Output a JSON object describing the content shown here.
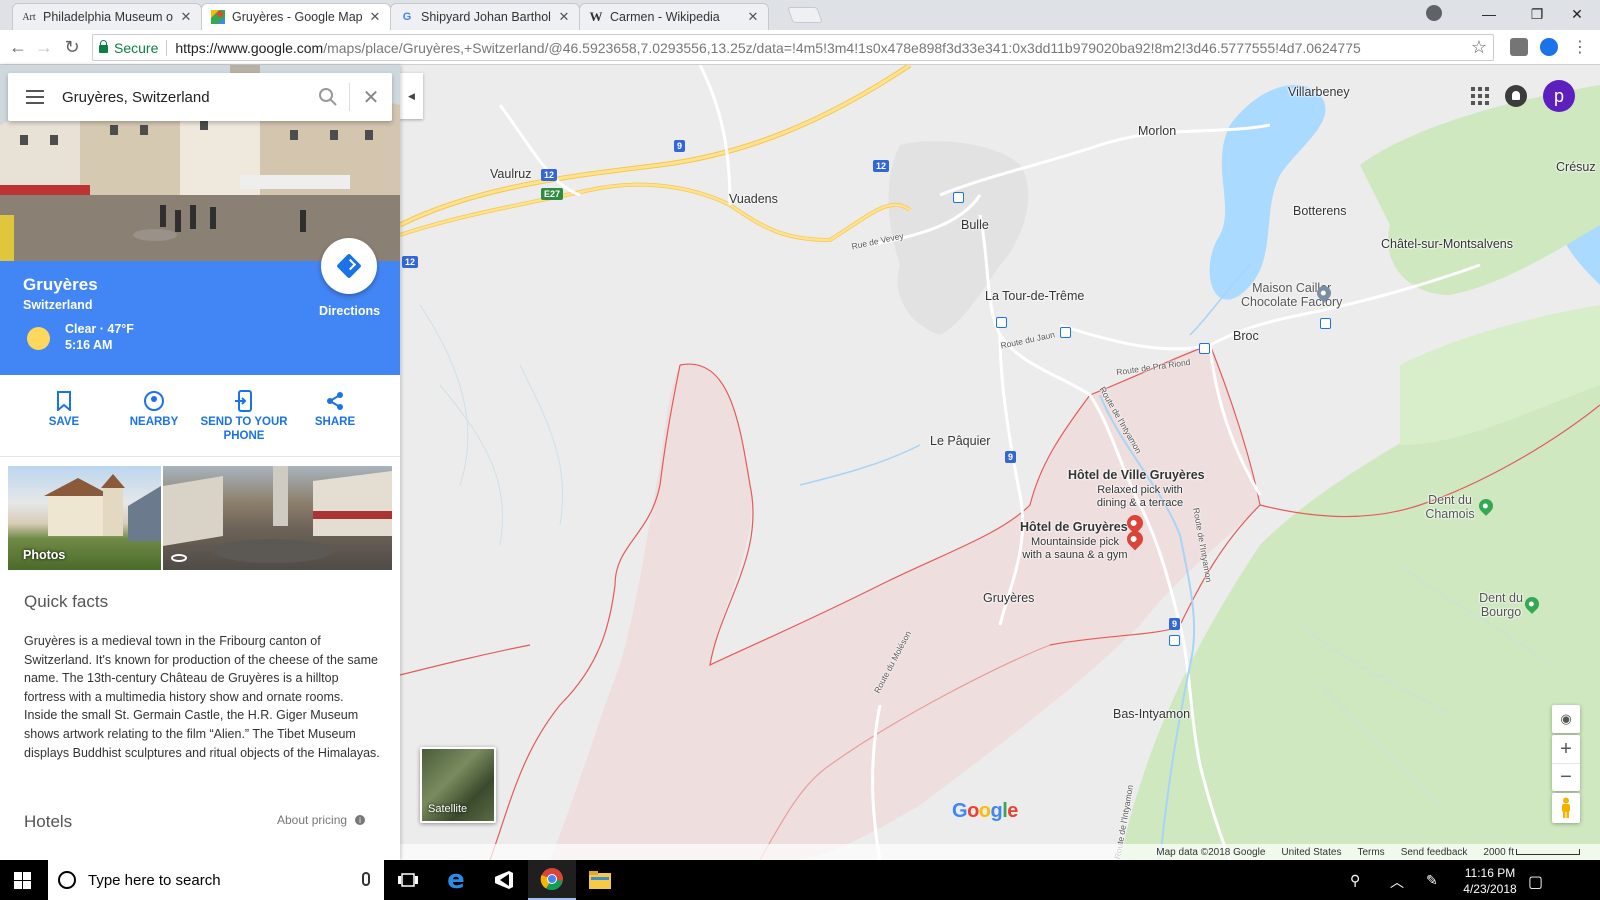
{
  "browser": {
    "tabs": [
      {
        "title": "Philadelphia Museum of",
        "favicon": "Art",
        "active": false
      },
      {
        "title": "Gruyères - Google Maps",
        "favicon": "maps-icon",
        "active": true
      },
      {
        "title": "Shipyard Johan Bartholo",
        "favicon": "G",
        "active": false
      },
      {
        "title": "Carmen - Wikipedia",
        "favicon": "W",
        "active": false
      }
    ],
    "secure_label": "Secure",
    "url_host": "https://www.google.com",
    "url_rest": "/maps/place/Gruyères,+Switzerland/@46.5923658,7.0293556,13.25z/data=!4m5!3m4!1s0x478e898f3d33e341:0x3dd11b979020ba92!8m2!3d46.5777555!4d7.0624775"
  },
  "search": {
    "value": "Gruyères, Switzerland"
  },
  "place": {
    "title": "Gruyères",
    "subtitle": "Switzerland",
    "weather": "Clear · 47°F",
    "time": "5:16 AM",
    "directions_label": "Directions"
  },
  "actions": [
    {
      "label": "SAVE",
      "icon": "bookmark-icon"
    },
    {
      "label": "NEARBY",
      "icon": "nearby-icon"
    },
    {
      "label": "SEND TO YOUR PHONE",
      "icon": "send-to-phone-icon"
    },
    {
      "label": "SHARE",
      "icon": "share-icon"
    }
  ],
  "photos_label": "Photos",
  "quick_facts": {
    "title": "Quick facts",
    "text": "Gruyères is a medieval town in the Fribourg canton of Switzerland. It's known for production of the cheese of the same name. The 13th-century Château de Gruyères is a hilltop fortress with a multimedia history show and ornate rooms. Inside the small St. Germain Castle, the H.R. Giger Museum shows artwork relating to the film “Alien.” The Tibet Museum displays Buddhist sculptures and ritual objects of the Himalayas."
  },
  "hotels": {
    "title": "Hotels",
    "about_pricing": "About pricing"
  },
  "map": {
    "places": {
      "vaulruz": "Vaulruz",
      "vuadens": "Vuadens",
      "bulle": "Bulle",
      "morlon": "Morlon",
      "villarbeney": "Villarbeney",
      "botterens": "Botterens",
      "chatel": "Châtel-sur-Montsalvens",
      "cresuz": "Crésuz",
      "tour_de_treme": "La Tour-de-Trême",
      "maison_cailler_1": "Maison Cailler",
      "maison_cailler_2": "Chocolate Factory",
      "broc": "Broc",
      "le_paquier": "Le Pâquier",
      "gruyeres": "Gruyères",
      "bas_intyamon": "Bas-Intyamon",
      "dent_du_chamois": "Dent du Chamois",
      "dent_du_bourgo": "Dent du Bourgo"
    },
    "roads": {
      "rue_de_vevey": "Rue de Vevey",
      "route_du_jaun": "Route du Jaun",
      "route_de_pra_riond": "Route de Pra Riond",
      "route_de_lintyamon": "Route de l'Intyamon",
      "route_du_moleson": "Route du Moléson",
      "route_de_lintyamon_2": "Route de l'Intyamon",
      "route_de_lintyamon_3": "Route de l'Intyamon"
    },
    "shields": [
      "9",
      "12",
      "12",
      "E27",
      "12",
      "9",
      "9"
    ],
    "hotels": [
      {
        "name": "Hôtel de Ville Gruyères",
        "desc": "Relaxed pick with dining & a terrace"
      },
      {
        "name": "Hôtel de Gruyères",
        "desc": "Mountainside pick with a sauna & a gym"
      }
    ],
    "satellite_label": "Satellite",
    "google_logo": "Google",
    "footer": {
      "map_data": "Map data ©2018 Google",
      "country": "United States",
      "terms": "Terms",
      "feedback": "Send feedback",
      "scale": "2000 ft"
    },
    "avatar_letter": "p"
  },
  "taskbar": {
    "search_placeholder": "Type here to search",
    "time": "11:16 PM",
    "date": "4/23/2018"
  },
  "colors": {
    "blue_header": "#4285f4",
    "accent": "#1a73e8",
    "boundary": "#e35b5b"
  }
}
